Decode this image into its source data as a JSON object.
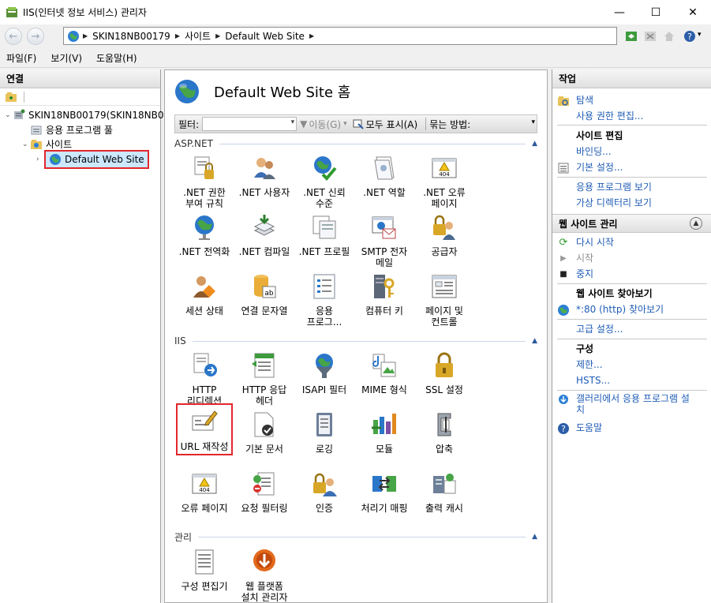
{
  "window": {
    "title": "IIS(인터넷 정보 서비스) 관리자",
    "minimize": "—",
    "maximize": "☐",
    "close": "✕"
  },
  "address": {
    "segments": [
      "SKIN18NB00179",
      "사이트",
      "Default Web Site"
    ]
  },
  "menu": [
    "파일(F)",
    "보기(V)",
    "도움말(H)"
  ],
  "left": {
    "header": "연결",
    "tree": [
      {
        "label": "SKIN18NB00179(SKIN18NB0",
        "level": 0,
        "expander": "⌄"
      },
      {
        "label": "응용 프로그램 풀",
        "level": 1,
        "expander": ""
      },
      {
        "label": "사이트",
        "level": 1,
        "expander": "⌄"
      },
      {
        "label": "Default Web Site",
        "level": 2,
        "expander": "›"
      }
    ]
  },
  "main": {
    "title": "Default Web Site 홈",
    "filter": {
      "label": "필터:",
      "go": "이동(G)",
      "show_all": "모두 표시(A)",
      "group_by": "묶는 방법:"
    },
    "sections": [
      {
        "label": "ASP.NET",
        "features": [
          {
            "label": ".NET 권한\n부여 규칙",
            "icon": "lock-icon"
          },
          {
            "label": ".NET 사용자",
            "icon": "users-icon"
          },
          {
            "label": ".NET 신뢰\n수준",
            "icon": "trust-icon"
          },
          {
            "label": ".NET 역할",
            "icon": "roles-icon"
          },
          {
            "label": ".NET 오류\n페이지",
            "icon": "error-404-icon"
          },
          {
            "label": ".NET 전역화",
            "icon": "globe-icon"
          },
          {
            "label": ".NET 컴파일",
            "icon": "compile-icon"
          },
          {
            "label": ".NET 프로필",
            "icon": "profile-icon"
          },
          {
            "label": "SMTP 전자\n메일",
            "icon": "mail-icon"
          },
          {
            "label": "공급자",
            "icon": "provider-icon"
          },
          {
            "label": "세션 상태",
            "icon": "session-icon"
          },
          {
            "label": "연결 문자열",
            "icon": "db-icon"
          },
          {
            "label": "응용\n프로그...",
            "icon": "app-settings-icon"
          },
          {
            "label": "컴퓨터 키",
            "icon": "machine-key-icon"
          },
          {
            "label": "페이지 및\n컨트롤",
            "icon": "pages-icon"
          }
        ]
      },
      {
        "label": "IIS",
        "features": [
          {
            "label": "HTTP\n리디렉션",
            "icon": "redirect-icon"
          },
          {
            "label": "HTTP 응답\n헤더",
            "icon": "headers-icon"
          },
          {
            "label": "ISAPI 필터",
            "icon": "isapi-icon"
          },
          {
            "label": "MIME 형식",
            "icon": "mime-icon"
          },
          {
            "label": "SSL 설정",
            "icon": "ssl-lock-icon"
          },
          {
            "label": "URL 재작성",
            "icon": "url-rewrite-icon"
          },
          {
            "label": "기본 문서",
            "icon": "default-doc-icon"
          },
          {
            "label": "로깅",
            "icon": "logging-icon"
          },
          {
            "label": "모듈",
            "icon": "modules-icon"
          },
          {
            "label": "압축",
            "icon": "compression-icon"
          },
          {
            "label": "오류 페이지",
            "icon": "error-pages-icon"
          },
          {
            "label": "요청 필터링",
            "icon": "request-filter-icon"
          },
          {
            "label": "인증",
            "icon": "auth-icon"
          },
          {
            "label": "처리기 매핑",
            "icon": "handler-icon"
          },
          {
            "label": "출력 캐시",
            "icon": "output-cache-icon"
          }
        ]
      },
      {
        "label": "관리",
        "features": [
          {
            "label": "구성 편집기",
            "icon": "config-editor-icon"
          },
          {
            "label": "웹 플랫폼\n설치 관리자",
            "icon": "web-platform-icon"
          }
        ]
      }
    ]
  },
  "right": {
    "header": "작업",
    "explore": "탐색",
    "edit_permissions": "사용 권한 편집...",
    "edit_site": "사이트 편집",
    "bindings": "바인딩...",
    "basic_settings": "기본 설정...",
    "view_apps": "응용 프로그램 보기",
    "view_vdirs": "가상 디렉터리 보기",
    "manage_header": "웹 사이트 관리",
    "restart": "다시 시작",
    "start": "시작",
    "stop": "중지",
    "browse_header": "웹 사이트 찾아보기",
    "browse_80": "*:80 (http) 찾아보기",
    "advanced": "고급 설정...",
    "config_header": "구성",
    "limits": "제한...",
    "hsts": "HSTS...",
    "gallery": "갤러리에서 응용 프로그램 설\n치",
    "help": "도움말"
  },
  "colors": {
    "link": "#1f5cb5",
    "selection_border": "#e2262b",
    "selection_fill": "#cce8ff"
  }
}
